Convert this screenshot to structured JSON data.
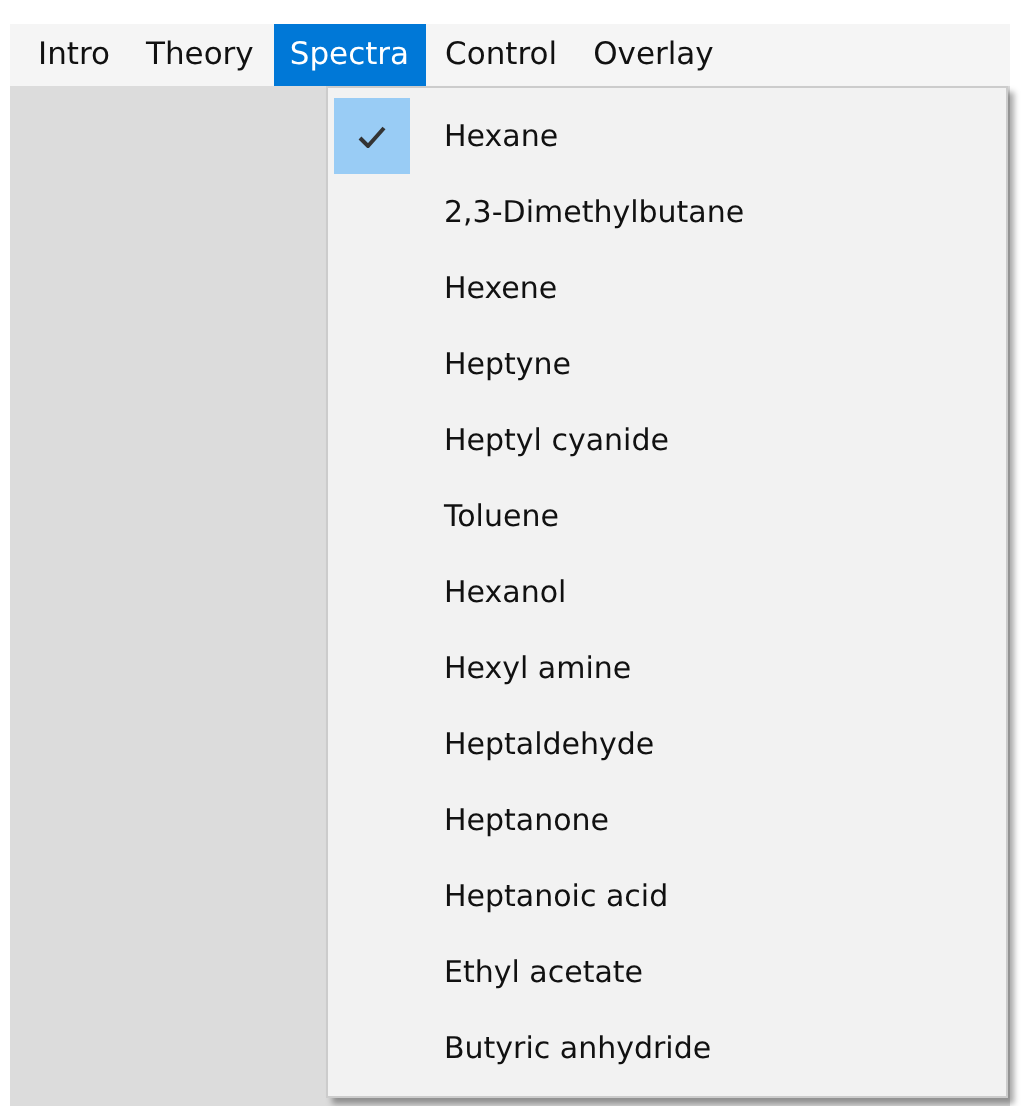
{
  "menu_bar": [
    {
      "label": "Intro",
      "selected": false
    },
    {
      "label": "Theory",
      "selected": false
    },
    {
      "label": "Spectra",
      "selected": true
    },
    {
      "label": "Control",
      "selected": false
    },
    {
      "label": "Overlay",
      "selected": false
    }
  ],
  "dropdown": {
    "items": [
      {
        "label": "Hexane",
        "checked": true
      },
      {
        "label": "2,3-Dimethylbutane",
        "checked": false
      },
      {
        "label": "Hexene",
        "checked": false
      },
      {
        "label": "Heptyne",
        "checked": false
      },
      {
        "label": "Heptyl cyanide",
        "checked": false
      },
      {
        "label": "Toluene",
        "checked": false
      },
      {
        "label": "Hexanol",
        "checked": false
      },
      {
        "label": "Hexyl amine",
        "checked": false
      },
      {
        "label": "Heptaldehyde",
        "checked": false
      },
      {
        "label": "Heptanone",
        "checked": false
      },
      {
        "label": "Heptanoic acid",
        "checked": false
      },
      {
        "label": "Ethyl acetate",
        "checked": false
      },
      {
        "label": "Butyric anhydride",
        "checked": false
      }
    ]
  }
}
